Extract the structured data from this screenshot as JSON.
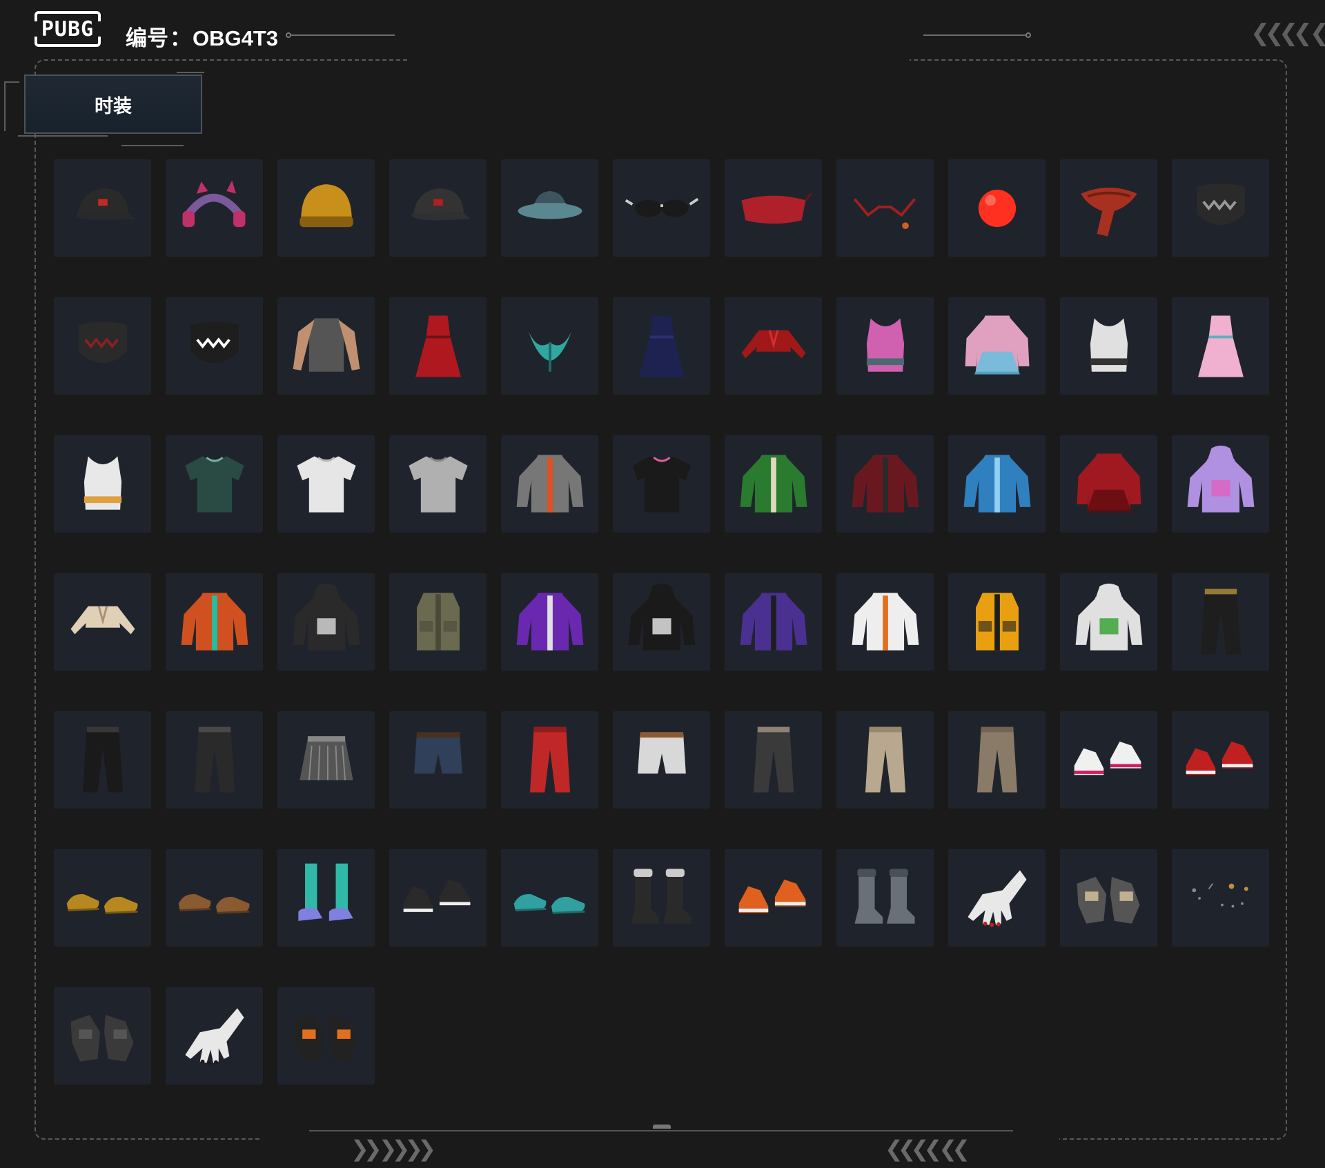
{
  "header": {
    "logo_text": "PUBG",
    "id_prefix": "编号",
    "id_colon": "：",
    "id_value": "OBG4T3",
    "top_right_chevrons": "❮❮❮❮ ❮",
    "footer_left_chevrons": "❯❯ ❯❯❯❯",
    "footer_right_chevrons": "❮❮❮❮ ❮❮"
  },
  "tabs": [
    {
      "label": "时装",
      "active": true
    }
  ],
  "colors": {
    "background": "#1a1a1b",
    "tile": "#1f242c",
    "frame": "#5a5a5a",
    "tab_bg": "#1f2833"
  },
  "items": [
    {
      "name": "black-baseball-cap",
      "icon": "cap",
      "colors": [
        "#2a2a2a",
        "#c62828"
      ]
    },
    {
      "name": "purple-cat-ear-headset",
      "icon": "headset",
      "colors": [
        "#7a5a9a",
        "#c0306a"
      ]
    },
    {
      "name": "yellow-beanie",
      "icon": "beanie",
      "colors": [
        "#c8901a",
        "#8a6010"
      ]
    },
    {
      "name": "black-cap-with-headphones",
      "icon": "cap",
      "colors": [
        "#333333",
        "#b02020"
      ]
    },
    {
      "name": "teal-bucket-hat",
      "icon": "buckethat",
      "colors": [
        "#3d5560",
        "#5a8890"
      ]
    },
    {
      "name": "sunglasses",
      "icon": "glasses",
      "colors": [
        "#1a1a1a",
        "#cccccc"
      ]
    },
    {
      "name": "red-eye-mask",
      "icon": "eyemask",
      "colors": [
        "#b0202a",
        "#701018"
      ]
    },
    {
      "name": "red-glasses-with-earring",
      "icon": "redglasses",
      "colors": [
        "#a02020",
        "#d06020"
      ]
    },
    {
      "name": "red-clown-nose",
      "icon": "ball",
      "colors": [
        "#ff3020",
        "#ff8070"
      ]
    },
    {
      "name": "red-bandana",
      "icon": "bandana",
      "colors": [
        "#a83020",
        "#702010"
      ]
    },
    {
      "name": "miramar-studded-mask",
      "icon": "mask",
      "colors": [
        "#2a2a2a",
        "#999999"
      ]
    },
    {
      "name": "black-red-face-mask",
      "icon": "mask",
      "colors": [
        "#2a2a2a",
        "#8a2020"
      ]
    },
    {
      "name": "shark-teeth-mask",
      "icon": "mask",
      "colors": [
        "#1e1e1e",
        "#ffffff"
      ]
    },
    {
      "name": "tattoo-sleeve-shirt",
      "icon": "longshirt",
      "colors": [
        "#555555",
        "#c09070"
      ]
    },
    {
      "name": "red-slip-dress",
      "icon": "dress",
      "colors": [
        "#b01820",
        "#701018"
      ]
    },
    {
      "name": "teal-bikini-top",
      "icon": "bikini",
      "colors": [
        "#30a8a0",
        "#206a66"
      ]
    },
    {
      "name": "navy-qipao-dress",
      "icon": "dress",
      "colors": [
        "#1e2250",
        "#2a3070"
      ]
    },
    {
      "name": "red-crop-jacket",
      "icon": "cropjacket",
      "colors": [
        "#a01818",
        "#d03030"
      ]
    },
    {
      "name": "pink-sequin-top",
      "icon": "tanktop",
      "colors": [
        "#d060b0",
        "#4a6a70"
      ]
    },
    {
      "name": "pink-fur-holo-dress",
      "icon": "coat",
      "colors": [
        "#e0a0c0",
        "#60c0e0"
      ]
    },
    {
      "name": "white-sports-bra",
      "icon": "tanktop",
      "colors": [
        "#e0e0e0",
        "#333333"
      ]
    },
    {
      "name": "pink-sequin-skirt-outfit",
      "icon": "dress",
      "colors": [
        "#f0b0d0",
        "#60b0c0"
      ]
    },
    {
      "name": "white-rainbow-tank",
      "icon": "tanktop",
      "colors": [
        "#e8e8e8",
        "#e0a040"
      ]
    },
    {
      "name": "floral-shirt",
      "icon": "tshirt",
      "colors": [
        "#2a4a44",
        "#7ab0a0"
      ]
    },
    {
      "name": "white-tshirt",
      "icon": "tshirt",
      "colors": [
        "#e6e6e6",
        "#bbbbbb"
      ]
    },
    {
      "name": "grey-tshirt",
      "icon": "tshirt",
      "colors": [
        "#b0b0b0",
        "#888888"
      ]
    },
    {
      "name": "grey-orange-jacket",
      "icon": "jacket",
      "colors": [
        "#777777",
        "#e05020"
      ]
    },
    {
      "name": "dog-print-tshirt",
      "icon": "tshirt",
      "colors": [
        "#1a1a1a",
        "#e060a0"
      ]
    },
    {
      "name": "green-puffer-jacket",
      "icon": "jacket",
      "colors": [
        "#2a7a30",
        "#e0d8c0"
      ]
    },
    {
      "name": "maroon-leather-jacket",
      "icon": "jacket",
      "colors": [
        "#6a1820",
        "#2a2a2a"
      ]
    },
    {
      "name": "holographic-blue-jacket",
      "icon": "jacket",
      "colors": [
        "#3080c0",
        "#90d0f0"
      ]
    },
    {
      "name": "red-leather-coat",
      "icon": "coat",
      "colors": [
        "#a01820",
        "#600c10"
      ]
    },
    {
      "name": "purple-devil-hoodie",
      "icon": "hoodie",
      "colors": [
        "#b090e0",
        "#e060c0"
      ]
    },
    {
      "name": "beige-crop-jacket",
      "icon": "cropjacket",
      "colors": [
        "#e0d0b8",
        "#a89070"
      ]
    },
    {
      "name": "orange-teal-jacket",
      "icon": "jacket",
      "colors": [
        "#d05020",
        "#20c0a0"
      ]
    },
    {
      "name": "black-white-hooded-jacket",
      "icon": "hoodie",
      "colors": [
        "#2a2a2a",
        "#dddddd"
      ]
    },
    {
      "name": "olive-tactical-vest",
      "icon": "vest",
      "colors": [
        "#6a6a50",
        "#4a4a38"
      ]
    },
    {
      "name": "purple-varsity-jacket",
      "icon": "jacket",
      "colors": [
        "#6a28b0",
        "#e0e0e0"
      ]
    },
    {
      "name": "black-checkered-hoodie",
      "icon": "hoodie",
      "colors": [
        "#1a1a1a",
        "#eeeeee"
      ]
    },
    {
      "name": "purple-camo-jacket",
      "icon": "jacket",
      "colors": [
        "#4a3090",
        "#1e1e1e"
      ]
    },
    {
      "name": "white-orange-jacket",
      "icon": "jacket",
      "colors": [
        "#eeeeee",
        "#e07020"
      ]
    },
    {
      "name": "yellow-puffer-vest",
      "icon": "vest",
      "colors": [
        "#e8a010",
        "#1e1e1e"
      ]
    },
    {
      "name": "white-green-hoodie",
      "icon": "hoodie",
      "colors": [
        "#e0e0e0",
        "#30a030"
      ]
    },
    {
      "name": "black-gold-pants",
      "icon": "pants",
      "colors": [
        "#1e1e1e",
        "#c8a040"
      ]
    },
    {
      "name": "black-leather-pants",
      "icon": "pants",
      "colors": [
        "#1a1a1a",
        "#444444"
      ]
    },
    {
      "name": "black-cargo-pants",
      "icon": "pants",
      "colors": [
        "#2a2a2a",
        "#555555"
      ]
    },
    {
      "name": "grey-pleated-skirt",
      "icon": "skirt",
      "colors": [
        "#555555",
        "#888888"
      ]
    },
    {
      "name": "denim-shorts-with-leg",
      "icon": "shorts",
      "colors": [
        "#30405a",
        "#4a3020"
      ]
    },
    {
      "name": "red-track-pants",
      "icon": "pants",
      "colors": [
        "#c02828",
        "#801818"
      ]
    },
    {
      "name": "white-cargo-shorts",
      "icon": "shorts",
      "colors": [
        "#d8d8d8",
        "#8a5a30"
      ]
    },
    {
      "name": "camo-pants",
      "icon": "pants",
      "colors": [
        "#3a3a3a",
        "#b0a090"
      ]
    },
    {
      "name": "khaki-pants",
      "icon": "pants",
      "colors": [
        "#b8a890",
        "#8a7a60"
      ]
    },
    {
      "name": "brown-pants",
      "icon": "pants",
      "colors": [
        "#8a7a68",
        "#6a5a48"
      ]
    },
    {
      "name": "white-sneakers",
      "icon": "sneakers",
      "colors": [
        "#f0f0f0",
        "#d02060"
      ]
    },
    {
      "name": "red-high-tops",
      "icon": "sneakers",
      "colors": [
        "#c02020",
        "#f0f0f0"
      ]
    },
    {
      "name": "tan-shoes",
      "icon": "shoes",
      "colors": [
        "#b88820",
        "#7a5a10"
      ]
    },
    {
      "name": "bear-paw-slippers",
      "icon": "shoes",
      "colors": [
        "#8a5a30",
        "#5a3a20"
      ]
    },
    {
      "name": "checkered-socks-purple-clogs",
      "icon": "socks",
      "colors": [
        "#30b8a8",
        "#8080e0"
      ]
    },
    {
      "name": "black-white-sneakers",
      "icon": "sneakers",
      "colors": [
        "#2a2a2a",
        "#eeeeee"
      ]
    },
    {
      "name": "teal-clogs",
      "icon": "shoes",
      "colors": [
        "#30a0a0",
        "#206a6a"
      ]
    },
    {
      "name": "black-fur-boots",
      "icon": "boots",
      "colors": [
        "#2a2a2a",
        "#cccccc"
      ]
    },
    {
      "name": "orange-sneakers",
      "icon": "sneakers",
      "colors": [
        "#e06020",
        "#f0f0f0"
      ]
    },
    {
      "name": "grey-work-boots",
      "icon": "boots",
      "colors": [
        "#6a7078",
        "#4a5058"
      ]
    },
    {
      "name": "white-hand-red-nails",
      "icon": "hand",
      "colors": [
        "#e8e8e8",
        "#c02020"
      ]
    },
    {
      "name": "fingerless-gloves",
      "icon": "gloves",
      "colors": [
        "#555555",
        "#c0b090"
      ]
    },
    {
      "name": "earring-piercings",
      "icon": "jewelry",
      "colors": [
        "#888888",
        "#c09040"
      ]
    },
    {
      "name": "wrapped-hand-bandages",
      "icon": "gloves",
      "colors": [
        "#3a3a3a",
        "#555555"
      ]
    },
    {
      "name": "white-hand-black-nails",
      "icon": "hand",
      "colors": [
        "#e8e8e8",
        "#1a1a1a"
      ]
    },
    {
      "name": "black-orange-gloves",
      "icon": "gloves",
      "colors": [
        "#222222",
        "#e07020"
      ]
    }
  ]
}
